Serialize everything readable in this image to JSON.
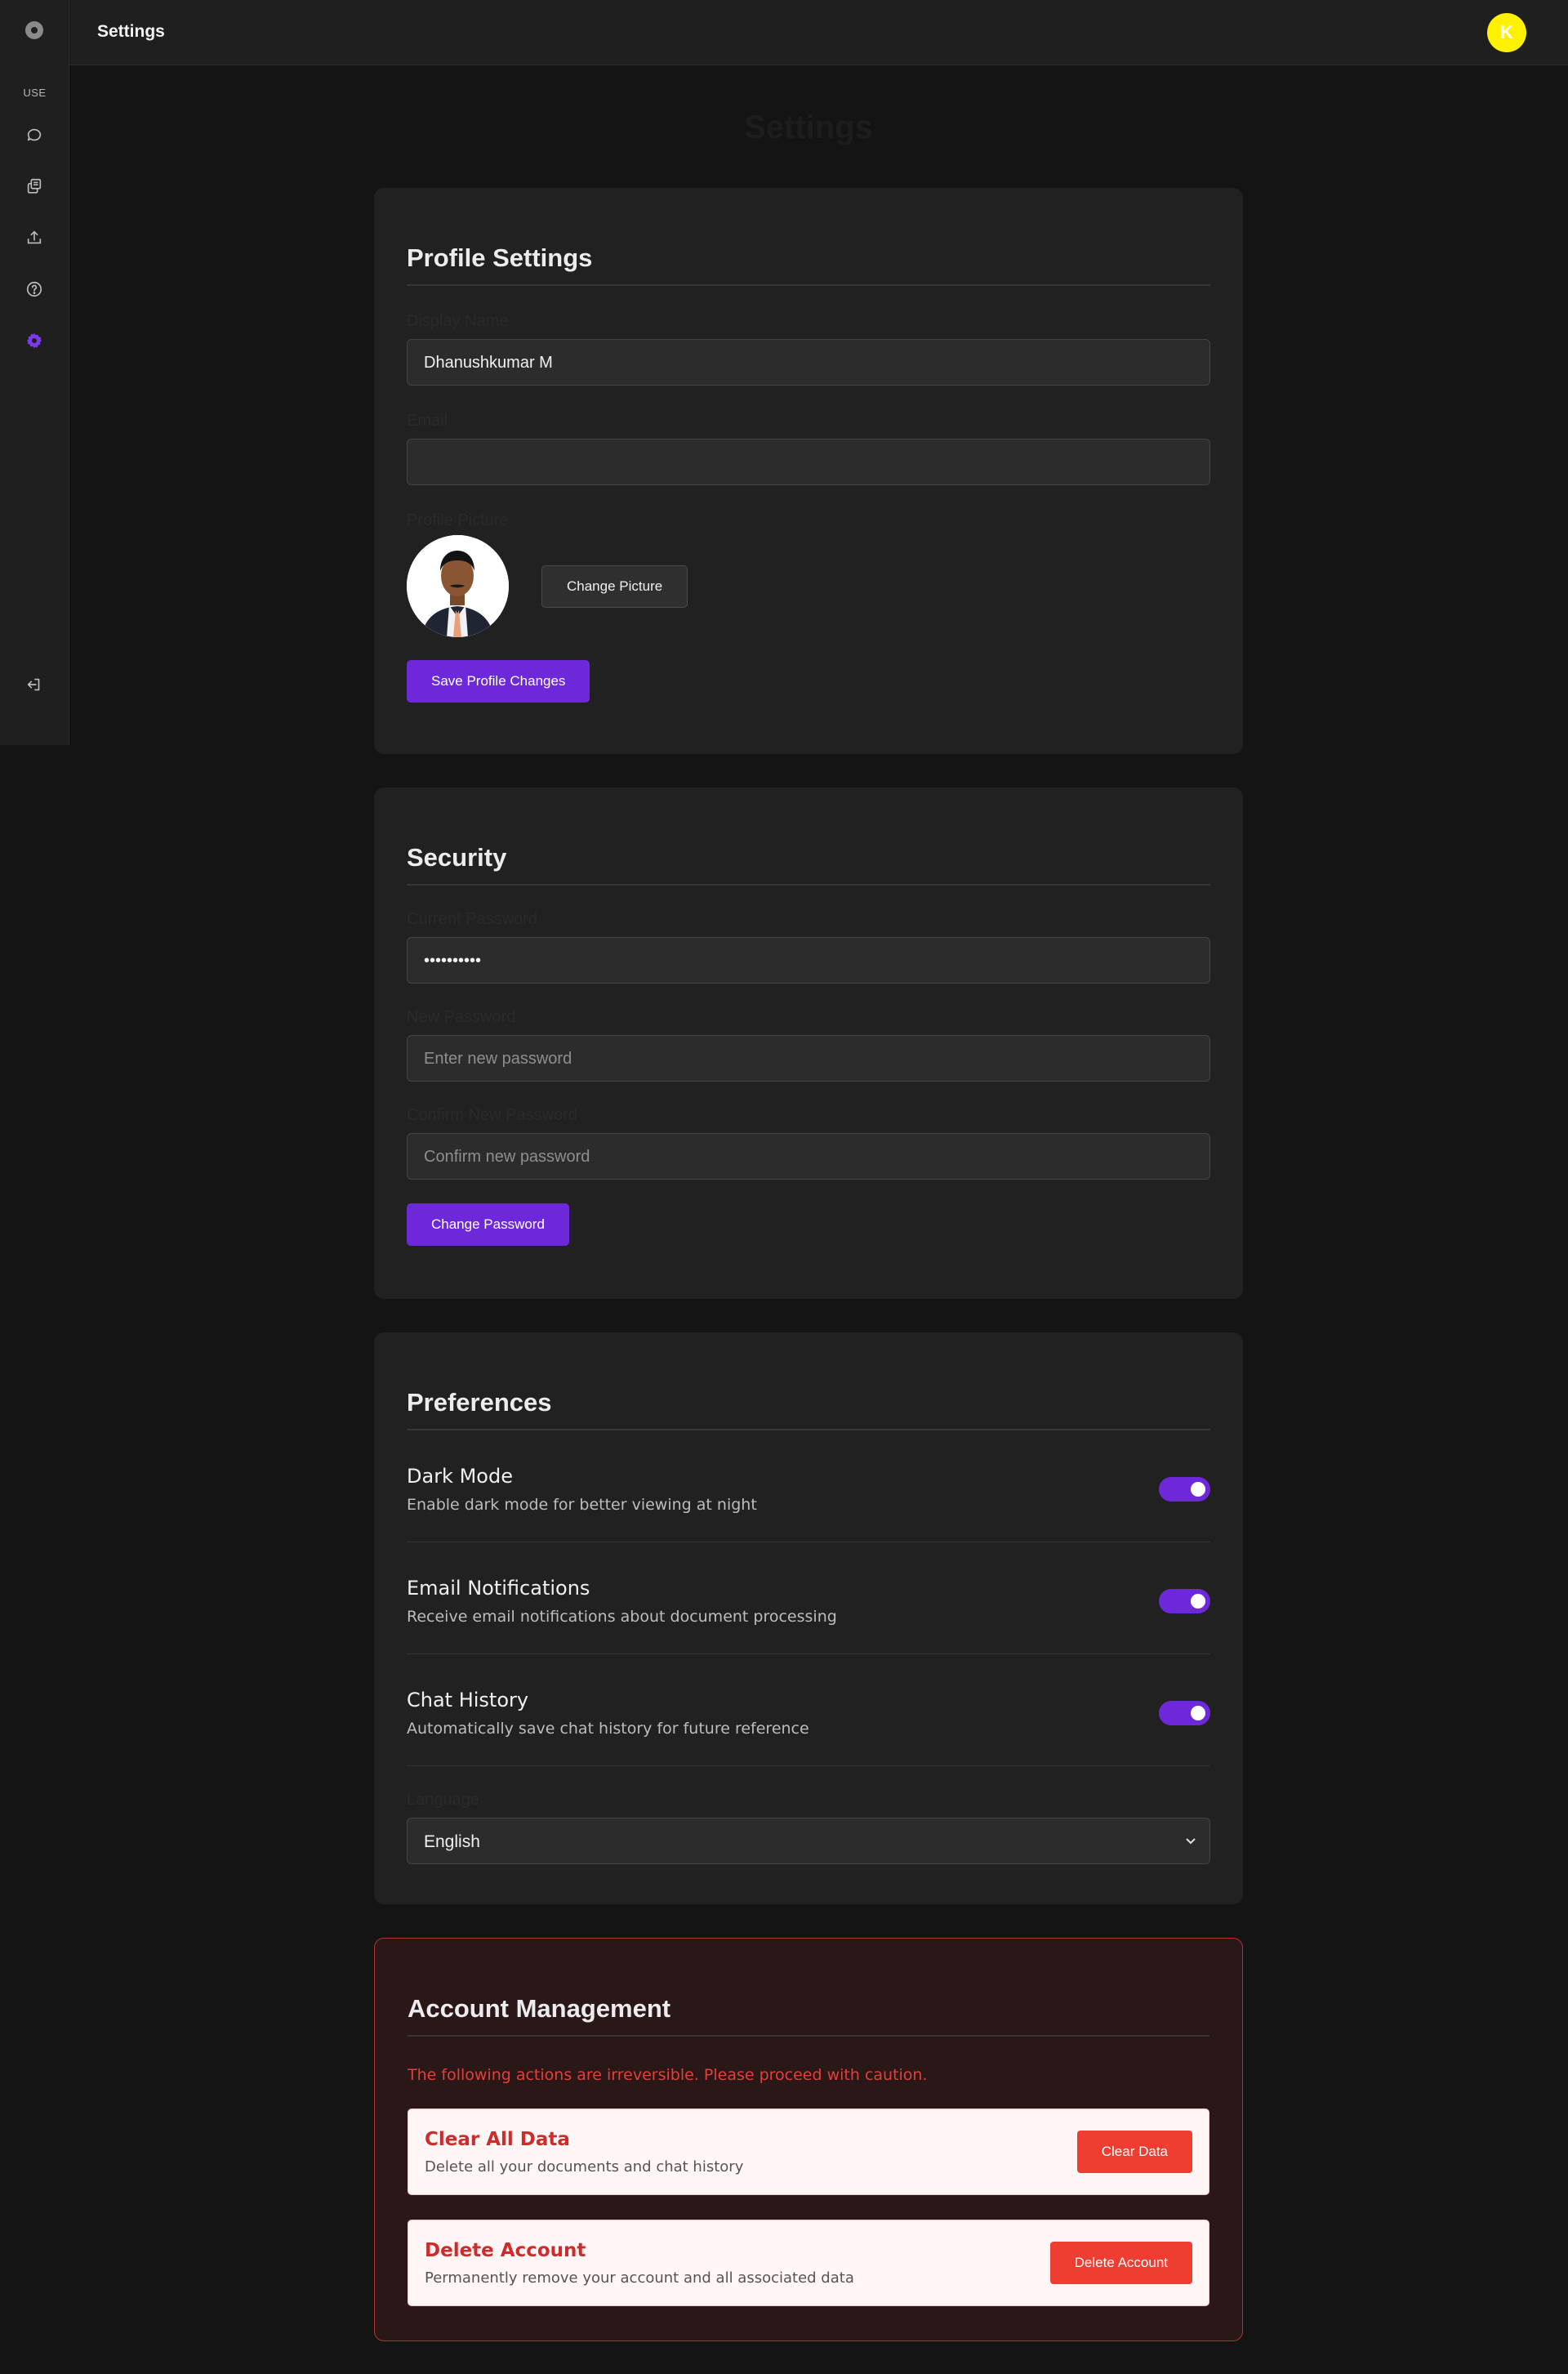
{
  "header": {
    "title": "Settings",
    "user_initial": "K"
  },
  "sidebar": {
    "section_label": "USE",
    "items": [
      {
        "icon": "chat-bubble-icon"
      },
      {
        "icon": "documents-icon"
      },
      {
        "icon": "upload-icon"
      },
      {
        "icon": "help-icon"
      },
      {
        "icon": "settings-icon",
        "active": true
      },
      {
        "icon": "logout-icon"
      }
    ]
  },
  "page": {
    "heading": "Settings"
  },
  "profile": {
    "title": "Profile Settings",
    "display_name_label": "Display Name",
    "display_name_value": "Dhanushkumar M",
    "email_label": "Email",
    "email_value": "",
    "picture_label": "Profile Picture",
    "change_picture": "Change Picture",
    "save": "Save Profile Changes"
  },
  "security": {
    "title": "Security",
    "current_password_label": "Current Password",
    "current_password_value": "••••••••••",
    "new_password_label": "New Password",
    "new_password_placeholder": "Enter new password",
    "confirm_password_label": "Confirm New Password",
    "confirm_password_placeholder": "Confirm new password",
    "change": "Change Password"
  },
  "preferences": {
    "title": "Preferences",
    "items": [
      {
        "title": "Dark Mode",
        "desc": "Enable dark mode for better viewing at night",
        "enabled": true
      },
      {
        "title": "Email Notifications",
        "desc": "Receive email notifications about document processing",
        "enabled": true
      },
      {
        "title": "Chat History",
        "desc": "Automatically save chat history for future reference",
        "enabled": true
      }
    ],
    "language_label": "Language",
    "language_value": "English"
  },
  "account": {
    "title": "Account Management",
    "warning": "The following actions are irreversible. Please proceed with caution.",
    "clear_title": "Clear All Data",
    "clear_desc": "Delete all your documents and chat history",
    "clear_button": "Clear Data",
    "delete_title": "Delete Account",
    "delete_desc": "Permanently remove your account and all associated data",
    "delete_button": "Delete Account"
  },
  "colors": {
    "accent": "#6d28d9",
    "danger": "#ef3d32",
    "avatar": "#fff200"
  }
}
